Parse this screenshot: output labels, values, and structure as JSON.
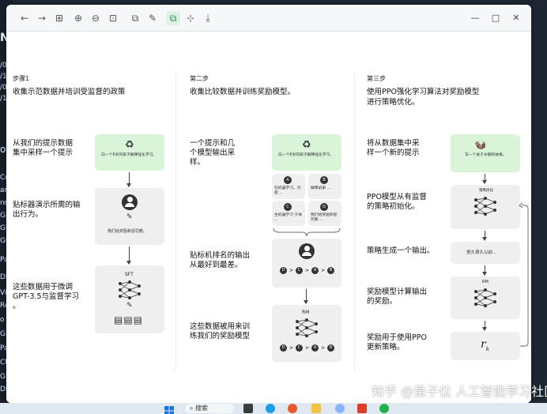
{
  "background": {
    "left_fragments": [
      "N",
      "/0",
      "/1",
      "/0",
      "/1",
      "of",
      "Co",
      "an",
      "rel",
      "GP",
      "GP",
      "GP",
      "Pal",
      "DP",
      "ViT",
      "Rec",
      "o G",
      "GP",
      "Pal",
      "Cha",
      "GP",
      "DP"
    ]
  },
  "toolbar": {
    "back_icon": "←",
    "forward_icon": "→",
    "grid_icon": "⊞",
    "zoom_in_icon": "⊕",
    "zoom_out_icon": "⊖",
    "fit_icon": "⊡",
    "copy_icon": "⧉",
    "edit_icon": "✎",
    "active_icon": "⧉",
    "crop_icon": "⊹",
    "save_icon": "⤓",
    "minimize": "—",
    "maximize": "□",
    "close": "✕"
  },
  "diagram": {
    "col1": {
      "head": "步骤1",
      "desc": "收集示范数据并培训受监督的政策",
      "text1": [
        "从我们的提示数据",
        "集中采样一个提示"
      ],
      "text2": [
        "贴标器演示所需的输",
        "出行为。"
      ],
      "text3": [
        "这些数据用于微调",
        "GPT-3.5与监督学习",
        "。"
      ],
      "card1_text": "向一个6岁的孩子解释强化学习。",
      "card2_text": "我们给奖励和惩罚教。",
      "card3_label": "SFT"
    },
    "col2": {
      "head": "第二步",
      "desc": "收集比较数据并训练奖励模型。",
      "text1": [
        "一个提示和几",
        "个模型输出采",
        "样。"
      ],
      "text2": [
        "贴标机排名的输出",
        "从最好到最差。"
      ],
      "text3": [
        "这些数据被用来训",
        "练我们的奖励模型"
      ],
      "card1_text": "向一个6岁的孩子解释强化学习。",
      "opt_a": "A",
      "opt_b": "B",
      "opt_c": "C",
      "opt_d": "D",
      "opt_a_text": "在机器学习，可能 ...",
      "opt_b_text": "解释战争 ...",
      "opt_c_text": "生机器学习 于体 ...",
      "opt_d_text": "我们给奖励和惩罚教 ...",
      "rank1": [
        "D",
        ">",
        "C",
        ">",
        "A",
        ">",
        "B"
      ],
      "rm_label": "RM",
      "rank2": [
        "D",
        ">",
        "C",
        ">",
        "A",
        ">",
        "B"
      ]
    },
    "col3": {
      "head": "第三步",
      "desc": [
        "使用PPO强化学习算法对奖励模型",
        "进行策略优化。"
      ],
      "text1": [
        "将从数据集中采",
        "样一个新的提示"
      ],
      "text2": [
        "PPO模型从有监督",
        "的策略初始化。"
      ],
      "text3": [
        "策略生成一个输出。"
      ],
      "text4": [
        "奖励模型计算输出",
        "的奖励。"
      ],
      "text5": [
        "奖励用于使用PPO",
        "更新策略。"
      ],
      "card1_text": "写一个关于水獭的故事。",
      "ppo_label": "策略优化",
      "card3_text": "很久很久以前...",
      "rm_label": "RM",
      "rk_label": "r",
      "rk_sub": "k"
    }
  },
  "watermark": {
    "text": "知乎 @量子位 人工智能学习社区"
  },
  "taskbar": {
    "search_label": "搜索"
  }
}
